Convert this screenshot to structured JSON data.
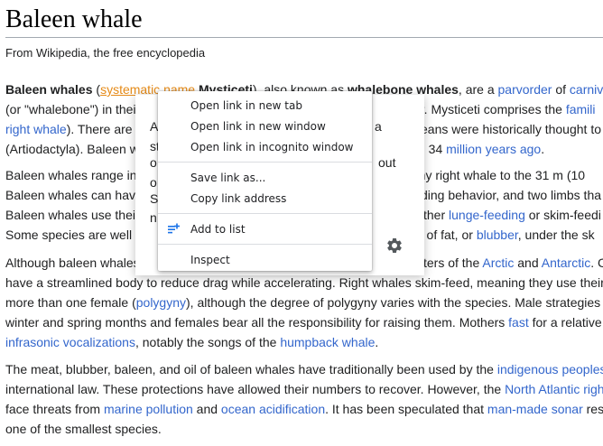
{
  "article": {
    "title": "Baleen whale",
    "tagline": "From Wikipedia, the free encyclopedia"
  },
  "p1": {
    "l1": {
      "t1": "Baleen whales",
      "t2": " (",
      "t3": "systematic name",
      "t4": " ",
      "t5": "Mysticeti",
      "t6": "), also known as ",
      "t7": "whalebone whales",
      "t8": ", are a ",
      "t9": "parvorder",
      "t10": " of ",
      "t11": "carniv"
    },
    "l2": {
      "t1": "(or \"whalebone\") in thei",
      "t2": "er. Mysticeti comprises the ",
      "t3": "famili"
    },
    "l3": {
      "t1": "right whale",
      "t2": "). There are",
      "t3": "eans were historically thought to"
    },
    "l4": {
      "t1": "(Artiodactyla). Baleen w",
      "t2": "d 34 ",
      "t3": "million years ago",
      "t4": "."
    }
  },
  "p2": {
    "l1": {
      "t1": "Baleen whales range in",
      "t2": "gmy right whale to the 31 m (10"
    },
    "l2": {
      "t1": "Baleen whales can hav",
      "t2": "ding behavior, and two limbs tha"
    },
    "l3": {
      "t1": "Baleen whales use thei",
      "t2": "ther ",
      "t3": "lunge-feeding",
      "t4": " or skim-feedi"
    },
    "l4": {
      "t1": "Some species are well",
      "t2": "r of fat, or ",
      "t3": "blubber",
      "t4": ", under the sk"
    }
  },
  "p3": {
    "l1": {
      "t1": "Although baleen whales",
      "t2": "ters of the ",
      "t3": "Arctic",
      "t4": " and ",
      "t5": "Antarctic",
      "t6": ". C"
    },
    "l2": {
      "t1": "have a streamlined body to reduce drag while accelerating. Right whales skim-feed, meaning they use their"
    },
    "l3": {
      "t1": "more than one female (",
      "t2": "polygyny",
      "t3": "), although the degree of polygyny varies with the species. Male strategies"
    },
    "l4": {
      "t1": "winter and spring months and females bear all the responsibility for raising them. Mothers ",
      "t2": "fast",
      "t3": " for a relative"
    },
    "l5": {
      "t1": "infrasonic vocalizations",
      "t2": ", notably the songs of the ",
      "t3": "humpback whale",
      "t4": "."
    }
  },
  "p4": {
    "l1": {
      "t1": "The meat, blubber, baleen, and oil of baleen whales have traditionally been used by the ",
      "t2": "indigenous peoples"
    },
    "l2": {
      "t1": "international law. These protections have allowed their numbers to recover. However, the ",
      "t2": "North Atlantic righ"
    },
    "l3": {
      "t1": "face threats from ",
      "t2": "marine pollution",
      "t3": " and ",
      "t4": "ocean acidification",
      "t5": ". It has been speculated that ",
      "t6": "man-made sonar",
      "t7": " res"
    },
    "l4": {
      "t1": "one of the smallest species."
    }
  },
  "popup": {
    "lines": [
      "A",
      "st",
      "o",
      "o",
      "S",
      "n"
    ],
    "tail": [
      "a",
      "out"
    ],
    "icon": "gear-icon"
  },
  "context_menu": {
    "items": [
      {
        "label": "Open link in new tab"
      },
      {
        "label": "Open link in new window"
      },
      {
        "label": "Open link in incognito window"
      },
      {
        "label": "Save link as..."
      },
      {
        "label": "Copy link address"
      },
      {
        "label": "Add to list",
        "icon": "add-to-list-icon"
      },
      {
        "label": "Inspect"
      }
    ],
    "accent": "#1a73e8"
  }
}
